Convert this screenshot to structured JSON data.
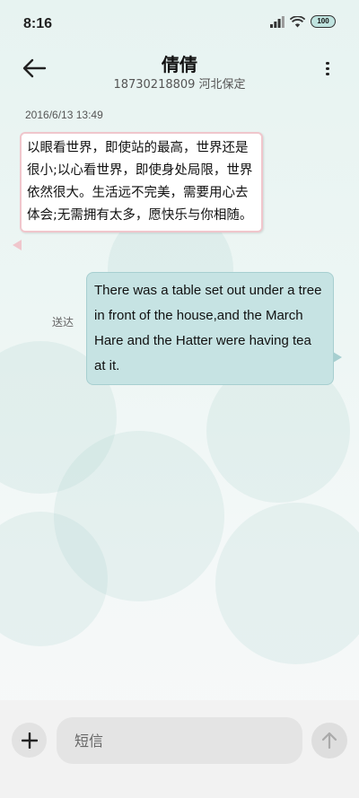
{
  "status_bar": {
    "time": "8:16",
    "battery_level": "100",
    "icons": [
      "signal-icon",
      "wifi-icon",
      "battery-icon"
    ]
  },
  "header": {
    "contact_name": "倩倩",
    "contact_detail": "18730218809 河北保定",
    "icons": [
      "back-arrow-icon",
      "more-vertical-icon"
    ]
  },
  "conversation": {
    "timestamp": "2016/6/13 13:49",
    "messages": [
      {
        "direction": "incoming",
        "text": "以眼看世界，即使站的最高，世界还是很小;以心看世界，即使身处局限，世界依然很大。生活远不完美，需要用心去体会;无需拥有太多，愿快乐与你相随。"
      },
      {
        "direction": "outgoing",
        "status": "送达",
        "text": "There was a table set out under a tree in front of the house,and the March Hare and the Hatter were having tea at it."
      }
    ]
  },
  "composer": {
    "placeholder": "短信",
    "value": "",
    "icons": [
      "plus-icon",
      "send-arrow-icon"
    ]
  },
  "colors": {
    "incoming_bubble": "#ffffff",
    "incoming_border": "#f0c6cc",
    "outgoing_bubble": "#c6e3e3",
    "background": "#e7f3f1"
  }
}
